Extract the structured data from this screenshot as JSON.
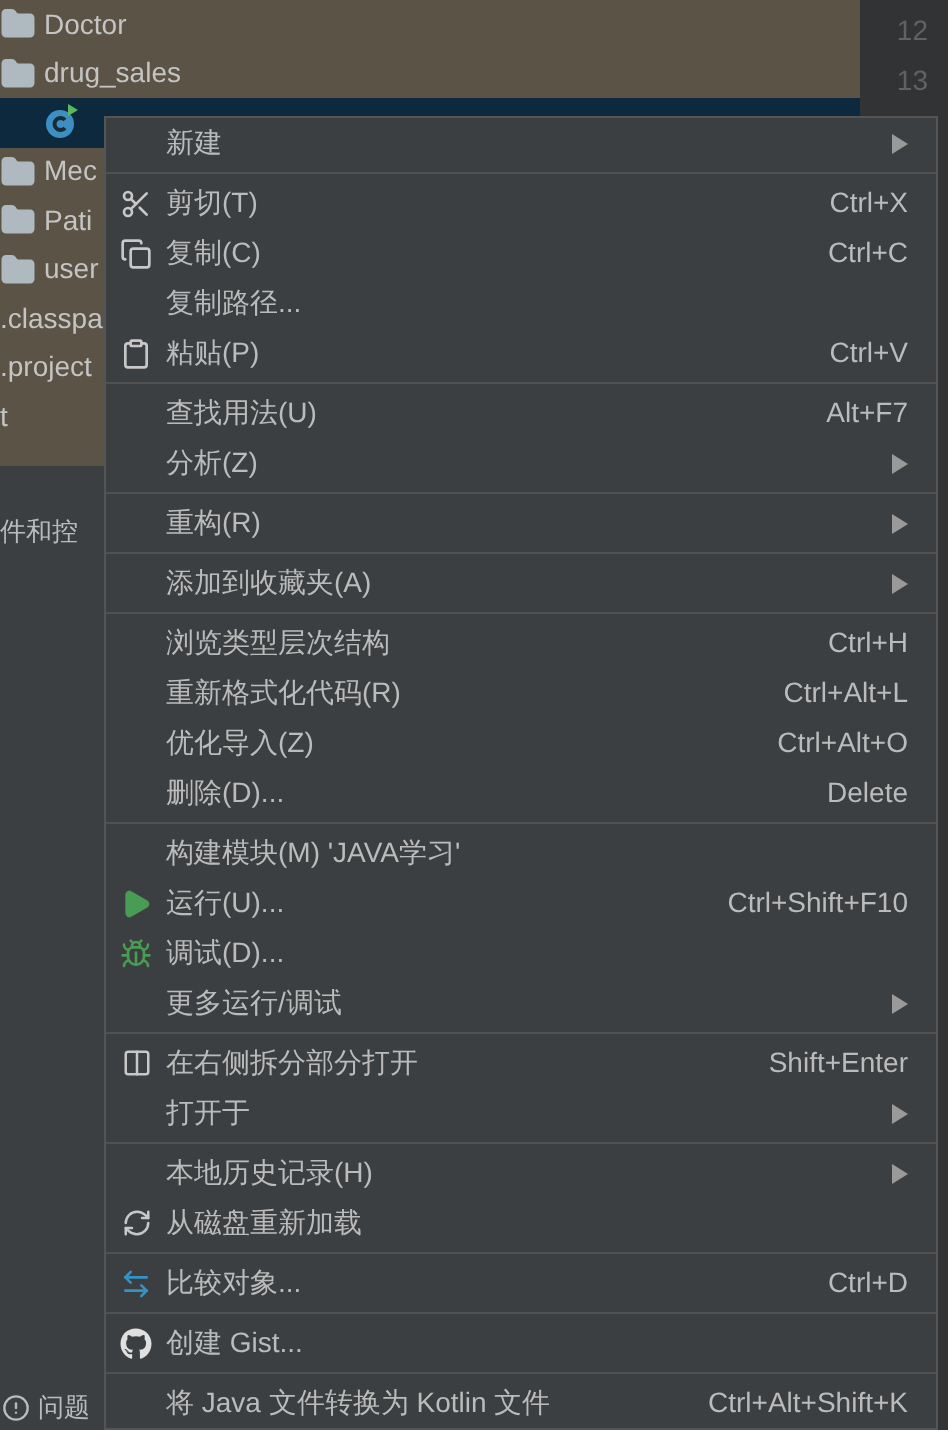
{
  "tree": [
    {
      "kind": "folder",
      "label": "Doctor",
      "selected": false
    },
    {
      "kind": "folder",
      "label": "drug_sales",
      "selected": false
    },
    {
      "kind": "class",
      "selected": true
    },
    {
      "kind": "folder",
      "label": "Mec",
      "selected": false
    },
    {
      "kind": "folder",
      "label": "Pati",
      "selected": false
    },
    {
      "kind": "folder",
      "label": "user",
      "selected": false
    },
    {
      "kind": "file",
      "label": ".classpa",
      "selected": false
    },
    {
      "kind": "file",
      "label": ".project",
      "selected": false
    },
    {
      "kind": "file",
      "label": "t",
      "selected": false
    }
  ],
  "panel_title": "件和控",
  "bottom_tab": "问题",
  "line_numbers": [
    "12",
    "13"
  ],
  "menu": [
    [
      {
        "label": "新建",
        "submenu": true
      }
    ],
    [
      {
        "label": "剪切(T)",
        "shortcut": "Ctrl+X",
        "submenu": false
      },
      {
        "label": "复制(C)",
        "shortcut": "Ctrl+C",
        "submenu": false
      },
      {
        "label": "复制路径...",
        "submenu": false
      },
      {
        "label": "粘贴(P)",
        "shortcut": "Ctrl+V",
        "submenu": false
      }
    ],
    [
      {
        "label": "查找用法(U)",
        "shortcut": "Alt+F7",
        "submenu": false
      },
      {
        "label": "分析(Z)",
        "submenu": true
      }
    ],
    [
      {
        "label": "重构(R)",
        "submenu": true
      }
    ],
    [
      {
        "label": "添加到收藏夹(A)",
        "submenu": true
      }
    ],
    [
      {
        "label": "浏览类型层次结构",
        "shortcut": "Ctrl+H",
        "submenu": false
      },
      {
        "label": "重新格式化代码(R)",
        "shortcut": "Ctrl+Alt+L",
        "submenu": false
      },
      {
        "label": "优化导入(Z)",
        "shortcut": "Ctrl+Alt+O",
        "submenu": false
      },
      {
        "label": "删除(D)...",
        "shortcut": "Delete",
        "submenu": false
      }
    ],
    [
      {
        "label": "构建模块(M) 'JAVA学习'",
        "submenu": false
      },
      {
        "label": "运行(U)...",
        "shortcut": "Ctrl+Shift+F10",
        "submenu": false
      },
      {
        "label": "调试(D)...",
        "submenu": false
      },
      {
        "label": "更多运行/调试",
        "submenu": true
      }
    ],
    [
      {
        "label": "在右侧拆分部分打开",
        "shortcut": "Shift+Enter",
        "submenu": false
      },
      {
        "label": "打开于",
        "submenu": true
      }
    ],
    [
      {
        "label": "本地历史记录(H)",
        "submenu": true
      },
      {
        "label": "从磁盘重新加载",
        "submenu": false
      }
    ],
    [
      {
        "label": "比较对象...",
        "shortcut": "Ctrl+D",
        "submenu": false
      }
    ],
    [
      {
        "label": "创建 Gist...",
        "submenu": false
      }
    ],
    [
      {
        "label": "将 Java 文件转换为 Kotlin 文件",
        "shortcut": "Ctrl+Alt+Shift+K",
        "submenu": false
      }
    ]
  ]
}
